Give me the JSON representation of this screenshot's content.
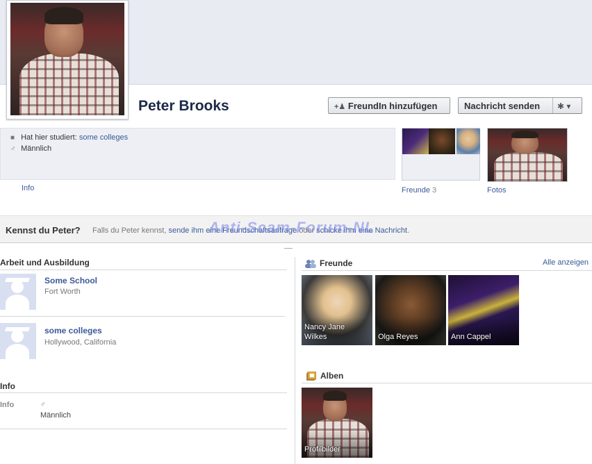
{
  "profile": {
    "name": "Peter Brooks",
    "add_friend_label": "FreundIn hinzufügen",
    "message_label": "Nachricht senden"
  },
  "intro": {
    "studied_prefix": "Hat hier studiert:",
    "studied_link": "some colleges",
    "gender": "Männlich",
    "info_tab": "Info"
  },
  "thumbs": {
    "friends_label": "Freunde",
    "friends_count": "3",
    "photos_label": "Fotos"
  },
  "know": {
    "title": "Kennst du Peter?",
    "text_prefix": "Falls du Peter kennst,",
    "link1": "sende ihm eine Freundschaftsanfrage",
    "text_mid": "oder",
    "link2": "schicke ihm eine Nachricht",
    "text_end": "."
  },
  "watermark": "Anti-Scam-Forum-NL",
  "work": {
    "title": "Arbeit und Ausbildung",
    "schools": [
      {
        "name": "Some School",
        "place": "Fort Worth"
      },
      {
        "name": "some colleges",
        "place": "Hollywood, California"
      }
    ]
  },
  "info_section": {
    "title": "Info",
    "label": "Info",
    "gender": "Männlich"
  },
  "friends_section": {
    "title": "Freunde",
    "all_link": "Alle anzeigen",
    "friends": [
      {
        "name": "Nancy Jane Wilkes"
      },
      {
        "name": "Olga Reyes"
      },
      {
        "name": "Ann Cappel"
      }
    ]
  },
  "albums_section": {
    "title": "Alben",
    "albums": [
      {
        "name": "Profilbilder"
      }
    ]
  },
  "icons": {
    "add_friend": "add-friend-icon",
    "gear": "gear-icon",
    "school": "graduation-cap-icon",
    "gender": "male-icon",
    "friends": "friends-icon",
    "albums": "album-icon"
  },
  "colors": {
    "link": "#3b5998",
    "cover": "#e8ebf2",
    "intro_bg": "#edeff4"
  }
}
